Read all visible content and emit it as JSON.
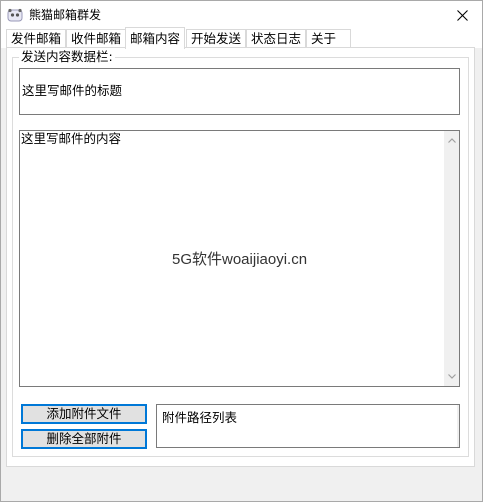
{
  "window": {
    "title": "熊猫邮箱群发"
  },
  "tabs": [
    {
      "label": "发件邮箱"
    },
    {
      "label": "收件邮箱"
    },
    {
      "label": "邮箱内容",
      "active": true
    },
    {
      "label": "开始发送"
    },
    {
      "label": "状态日志"
    },
    {
      "label": "关于"
    }
  ],
  "content": {
    "group_label": "发送内容数据栏:",
    "subject_placeholder": "这里写邮件的标题",
    "body_placeholder": "这里写邮件的内容",
    "watermark": "5G软件woaijiaoyi.cn"
  },
  "attachments": {
    "add_button": "添加附件文件",
    "delete_button": "删除全部附件",
    "list_label": "附件路径列表"
  },
  "colors": {
    "accent": "#0078d7",
    "button_bg": "#e1e1e1",
    "window_bg": "#f0f0f0"
  }
}
